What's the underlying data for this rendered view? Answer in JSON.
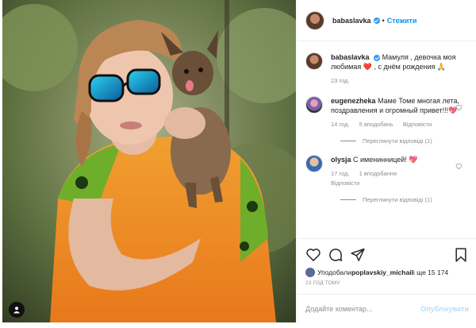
{
  "header": {
    "username": "babaslavka",
    "follow_label": "Стежити",
    "avatar_icon": "avatar-icon"
  },
  "caption": {
    "username": "babaslavka",
    "text": "Мамуля , девочка моя любимая ❤️ , с днём рождения 🙏",
    "time": "23 год."
  },
  "comments": [
    {
      "username": "eugenezheka",
      "text": "Маме Томе многая лета, поздравления и огромный привет!!!💖",
      "time": "14 год.",
      "likes": "5 вподобань",
      "reply": "Відповісти",
      "view_replies": "Переглянути відповіді (1)"
    },
    {
      "username": "olysja",
      "text": "С именинницей! 💖",
      "time": "17 год.",
      "likes": "1 вподобання",
      "reply": "Відповісти",
      "view_replies": "Переглянути відповіді (1)"
    }
  ],
  "likes": {
    "prefix": "Уподобали ",
    "user": "poplavskiy_michail",
    "suffix": " і ще 15 174"
  },
  "timestamp": "23 ГОД ТОМУ",
  "add_comment": {
    "placeholder": "Додайте коментар...",
    "publish_label": "Опублікувати"
  },
  "colors": {
    "link": "#0095f6",
    "verified": "#3897f0",
    "muted": "#8e8e8e",
    "heart": "#ed4956"
  }
}
